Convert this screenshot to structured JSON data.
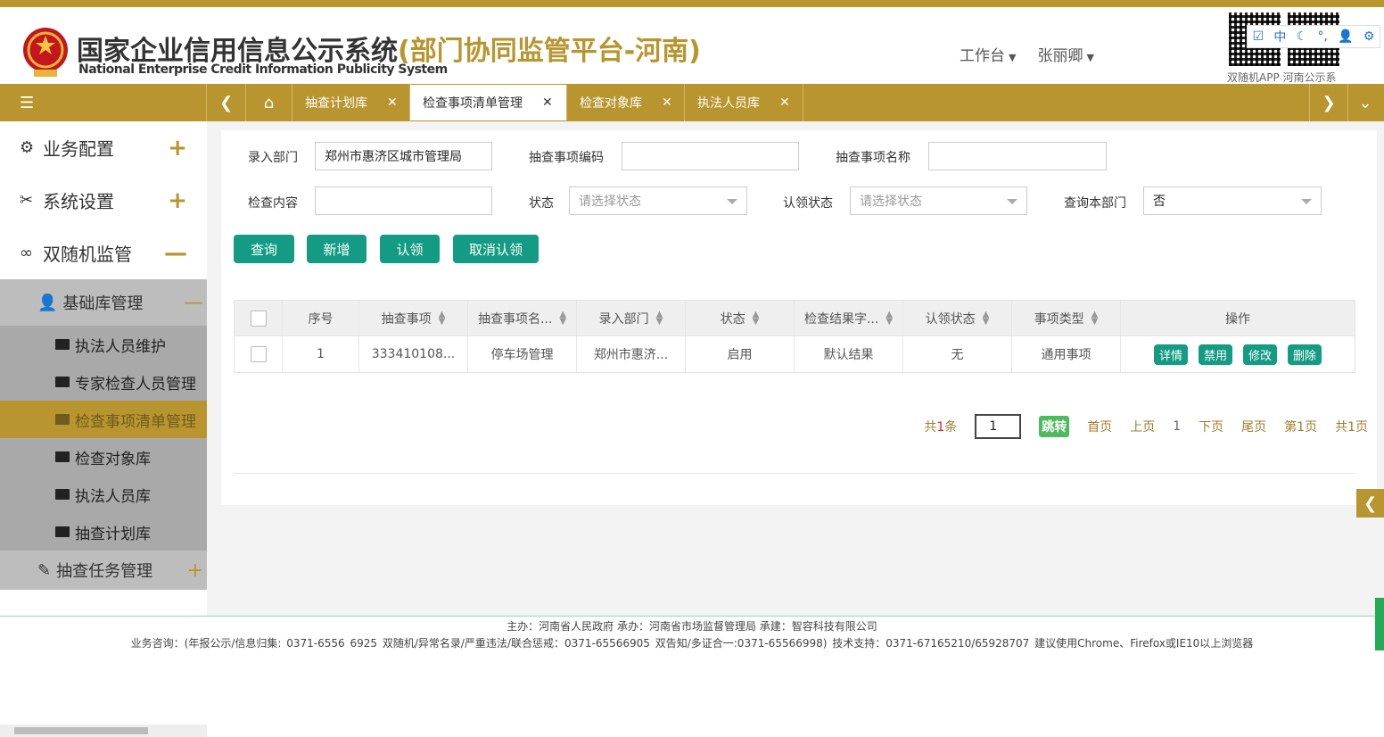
{
  "header": {
    "title_main": "国家企业信用信息公示系统",
    "title_sub": "(部门协同监管平台-河南)",
    "title_en": "National Enterprise Credit Information Publicity System",
    "workbench_label": "工作台",
    "username": "张丽卿",
    "qr_caption": "双随机APP  河南公示系"
  },
  "floating_tools": [
    "中"
  ],
  "tabs": [
    {
      "label": "抽查计划库",
      "active": false
    },
    {
      "label": "检查事项清单管理",
      "active": true
    },
    {
      "label": "检查对象库",
      "active": false
    },
    {
      "label": "执法人员库",
      "active": false
    }
  ],
  "sidebar": {
    "l1": [
      {
        "label": "业务配置",
        "sign": "+"
      },
      {
        "label": "系统设置",
        "sign": "+"
      },
      {
        "label": "双随机监管",
        "sign": "—"
      }
    ],
    "group": {
      "label": "基础库管理",
      "sign": "—"
    },
    "items": [
      {
        "label": "执法人员维护",
        "active": false
      },
      {
        "label": "专家检查人员管理",
        "active": false
      },
      {
        "label": "检查事项清单管理",
        "active": true
      },
      {
        "label": "检查对象库",
        "active": false
      },
      {
        "label": "执法人员库",
        "active": false
      },
      {
        "label": "抽查计划库",
        "active": false
      }
    ],
    "group2": {
      "label": "抽查任务管理",
      "sign": "+"
    }
  },
  "form": {
    "dept_label": "录入部门",
    "dept_value": "郑州市惠济区城市管理局",
    "code_label": "抽查事项编码",
    "code_value": "",
    "name_label": "抽查事项名称",
    "name_value": "",
    "content_label": "检查内容",
    "content_value": "",
    "status_label": "状态",
    "status_placeholder": "请选择状态",
    "claim_label": "认领状态",
    "claim_placeholder": "请选择状态",
    "self_dept_label": "查询本部门",
    "self_dept_value": "否"
  },
  "buttons": {
    "query": "查询",
    "add": "新增",
    "claim": "认领",
    "unclaim": "取消认领"
  },
  "table": {
    "headers": [
      "序号",
      "抽查事项",
      "抽查事项名...",
      "录入部门",
      "状态",
      "检查结果字...",
      "认领状态",
      "事项类型",
      "操作"
    ],
    "rows": [
      {
        "index": "1",
        "item": "333410108...",
        "name": "停车场管理",
        "dept": "郑州市惠济...",
        "status": "启用",
        "result": "默认结果",
        "claim": "无",
        "type": "通用事项",
        "ops": [
          "详情",
          "禁用",
          "修改",
          "删除"
        ]
      }
    ]
  },
  "pager": {
    "total_prefix": "共",
    "total_count": "1",
    "total_suffix": "条",
    "page_input": "1",
    "go": "跳转",
    "first": "首页",
    "prev": "上页",
    "current": "1",
    "next": "下页",
    "last": "尾页",
    "page_of": "第1页",
    "pages_total": "共1页"
  },
  "footer": {
    "line1": "主办：河南省人民政府  承办：河南省市场监督管理局  承建：智容科技有限公司",
    "line2": "业务咨询：(年报公示/信息归集: 0371-6556 6925      双随机/异常名录/严重违法/联合惩戒：0371-65566905      双告知/多证合一:0371-65566998)      技术支持：0371-67165210/65928707   建议使用Chrome、Firefox或IE10以上浏览器"
  },
  "colors": {
    "brand_gold": "#b8952e",
    "action_green": "#149b84"
  }
}
